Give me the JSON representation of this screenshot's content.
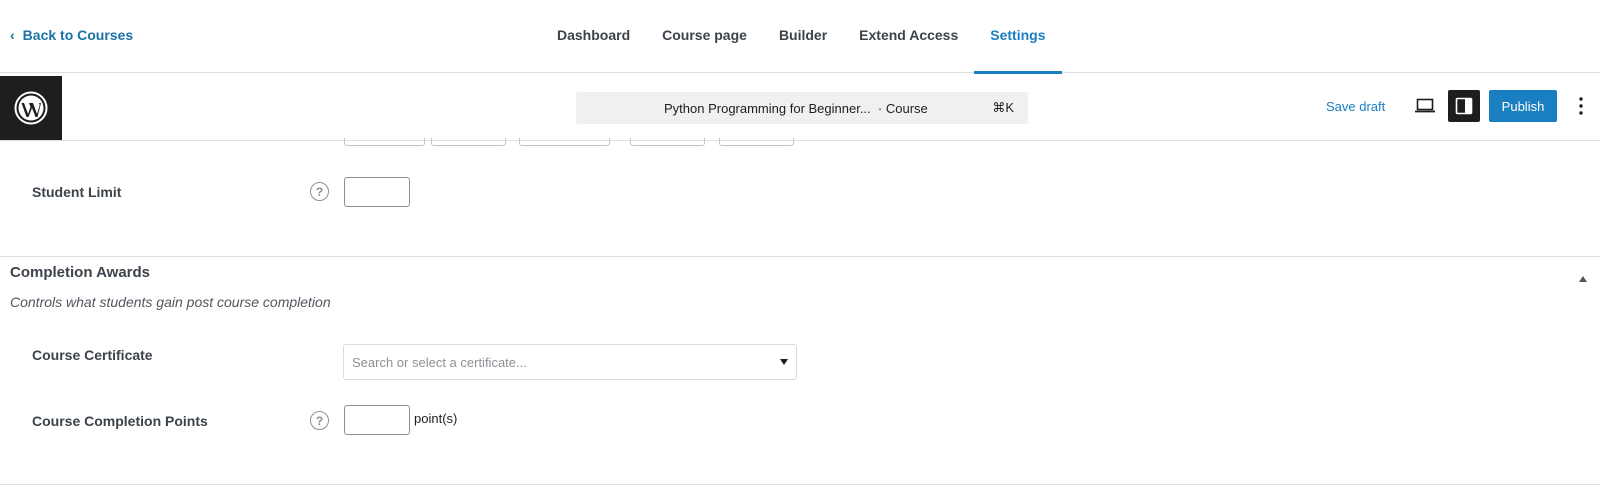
{
  "topbar": {
    "back_label": "Back to Courses",
    "tabs": [
      {
        "label": "Dashboard",
        "active": false
      },
      {
        "label": "Course page",
        "active": false
      },
      {
        "label": "Builder",
        "active": false
      },
      {
        "label": "Extend Access",
        "active": false
      },
      {
        "label": "Settings",
        "active": true
      }
    ]
  },
  "editor": {
    "logo_icon": "wordpress-icon",
    "document_title": "Python Programming for Beginner...",
    "document_type": "· Course",
    "shortcut": "⌘K",
    "save_draft_label": "Save draft",
    "preview_icon": "laptop-icon",
    "settings_icon": "sidebar-toggle-icon",
    "publish_label": "Publish",
    "more_icon": "kebab-menu-icon"
  },
  "access_section": {
    "student_limit": {
      "label": "Student Limit",
      "value": ""
    }
  },
  "completion_awards": {
    "title": "Completion Awards",
    "description": "Controls what students gain post course completion",
    "certificate": {
      "label": "Course Certificate",
      "placeholder": "Search or select a certificate..."
    },
    "points": {
      "label": "Course Completion Points",
      "value": "",
      "suffix": "point(s)"
    }
  },
  "colors": {
    "accent": "#1a7fc0",
    "text": "#3c434a",
    "dark": "#1e1e1e"
  }
}
